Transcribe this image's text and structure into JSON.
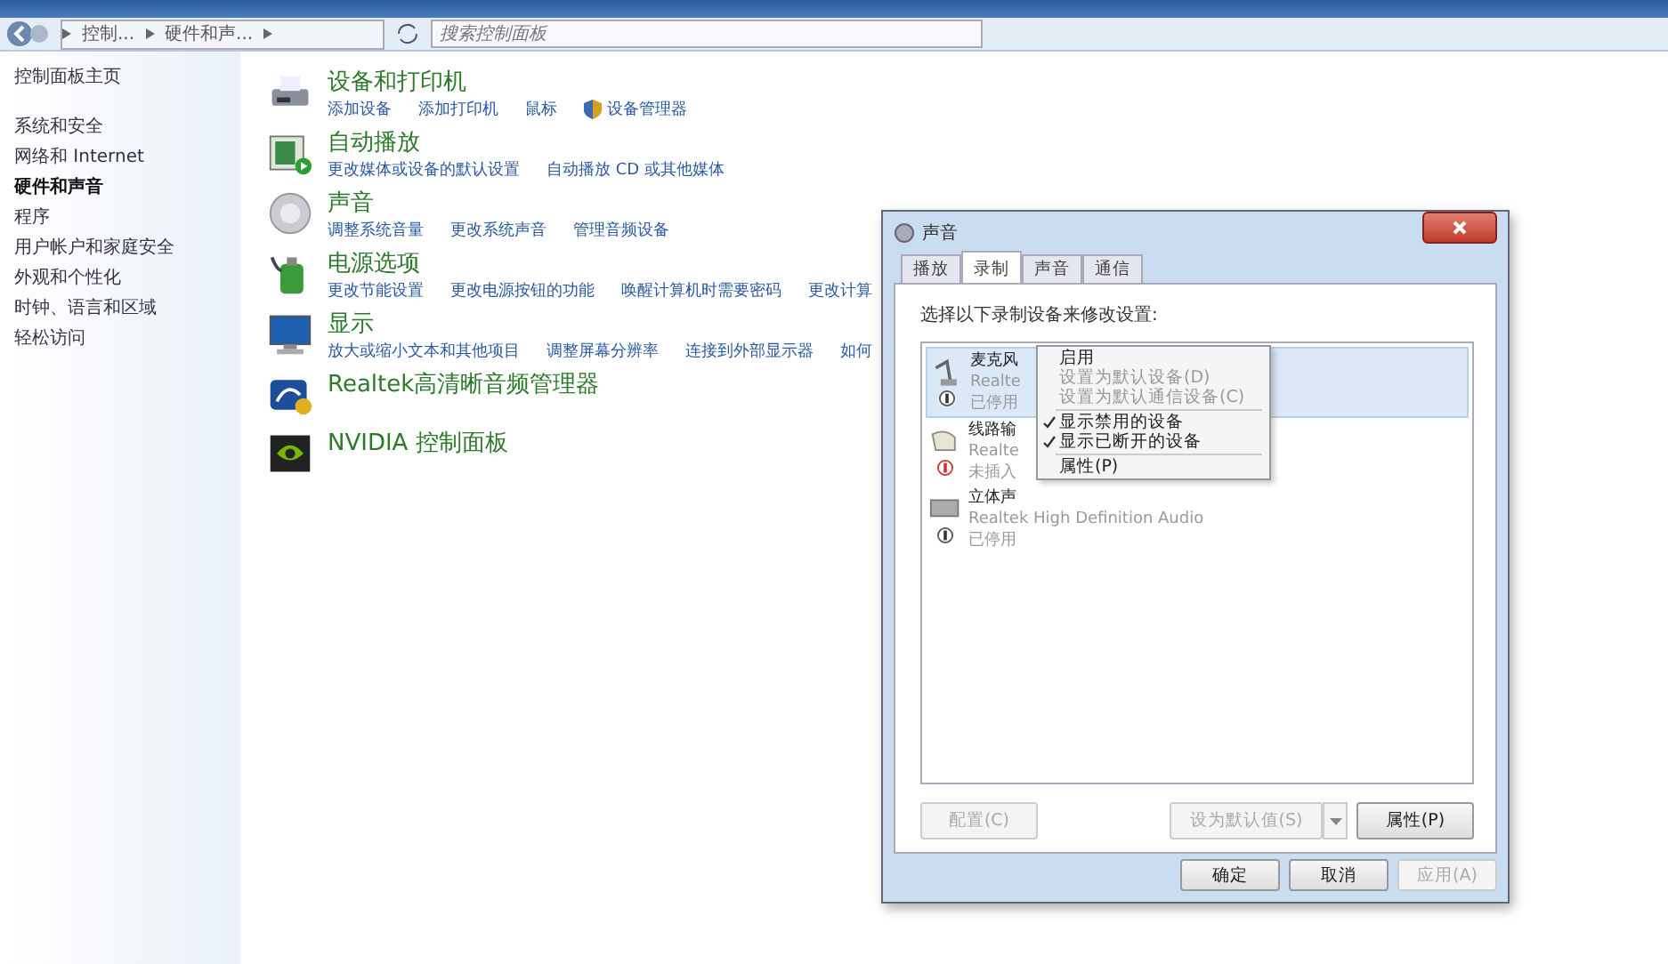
{
  "address_bar": {
    "crumbs": [
      "控制...",
      "硬件和声..."
    ]
  },
  "search": {
    "placeholder": "搜索控制面板"
  },
  "sidebar": {
    "home": "控制面板主页",
    "items": [
      {
        "label": "系统和安全",
        "selected": false
      },
      {
        "label": "网络和 Internet",
        "selected": false
      },
      {
        "label": "硬件和声音",
        "selected": true
      },
      {
        "label": "程序",
        "selected": false
      },
      {
        "label": "用户帐户和家庭安全",
        "selected": false
      },
      {
        "label": "外观和个性化",
        "selected": false
      },
      {
        "label": "时钟、语言和区域",
        "selected": false
      },
      {
        "label": "轻松访问",
        "selected": false
      }
    ]
  },
  "categories": [
    {
      "kind": "printer",
      "title": "设备和打印机",
      "links": [
        {
          "label": "添加设备"
        },
        {
          "label": "添加打印机"
        },
        {
          "label": "鼠标"
        },
        {
          "label": "设备管理器",
          "shield": true
        }
      ]
    },
    {
      "kind": "autoplay",
      "title": "自动播放",
      "links": [
        {
          "label": "更改媒体或设备的默认设置"
        },
        {
          "label": "自动播放 CD 或其他媒体"
        }
      ]
    },
    {
      "kind": "sound",
      "title": "声音",
      "links": [
        {
          "label": "调整系统音量"
        },
        {
          "label": "更改系统声音"
        },
        {
          "label": "管理音频设备"
        }
      ]
    },
    {
      "kind": "power",
      "title": "电源选项",
      "links": [
        {
          "label": "更改节能设置"
        },
        {
          "label": "更改电源按钮的功能"
        },
        {
          "label": "唤醒计算机时需要密码"
        },
        {
          "label": "更改计算"
        }
      ]
    },
    {
      "kind": "display",
      "title": "显示",
      "links": [
        {
          "label": "放大或缩小文本和其他项目"
        },
        {
          "label": "调整屏幕分辨率"
        },
        {
          "label": "连接到外部显示器"
        },
        {
          "label": "如何"
        }
      ]
    },
    {
      "kind": "realtek",
      "title": "Realtek高清晰音频管理器"
    },
    {
      "kind": "nvidia",
      "title": "NVIDIA 控制面板"
    }
  ],
  "dialog": {
    "title": "声音",
    "tabs": [
      {
        "label": "播放",
        "selected": false
      },
      {
        "label": "录制",
        "selected": true
      },
      {
        "label": "声音",
        "selected": false
      },
      {
        "label": "通信",
        "selected": false
      }
    ],
    "instruction": "选择以下录制设备来修改设置:",
    "devices": [
      {
        "kind": "mic",
        "name": "麦克风",
        "driver": "Realte",
        "status": "已停用",
        "selected": true
      },
      {
        "kind": "line",
        "name": "线路输",
        "driver": "Realte",
        "status": "未插入",
        "selected": false
      },
      {
        "kind": "mixer",
        "name": "立体声",
        "driver": "Realtek High Definition Audio",
        "status": "已停用",
        "selected": false
      }
    ],
    "context_menu": [
      {
        "kind": "item",
        "label": "启用",
        "disabled": false,
        "checked": false
      },
      {
        "kind": "item",
        "label": "设置为默认设备(D)",
        "disabled": true,
        "checked": false
      },
      {
        "kind": "item",
        "label": "设置为默认通信设备(C)",
        "disabled": true,
        "checked": false
      },
      {
        "kind": "separator"
      },
      {
        "kind": "item",
        "label": "显示禁用的设备",
        "disabled": false,
        "checked": true
      },
      {
        "kind": "item",
        "label": "显示已断开的设备",
        "disabled": false,
        "checked": true
      },
      {
        "kind": "separator"
      },
      {
        "kind": "item",
        "label": "属性(P)",
        "disabled": false,
        "checked": false
      }
    ],
    "configure_button": {
      "label": "配置(C)",
      "disabled": true
    },
    "set_default_button": {
      "label": "设为默认值(S)",
      "disabled": true
    },
    "properties_button": {
      "label": "属性(P)",
      "disabled": false
    },
    "footer_buttons": [
      {
        "label": "确定",
        "disabled": false
      },
      {
        "label": "取消",
        "disabled": false
      },
      {
        "label": "应用(A)",
        "disabled": true
      }
    ]
  }
}
